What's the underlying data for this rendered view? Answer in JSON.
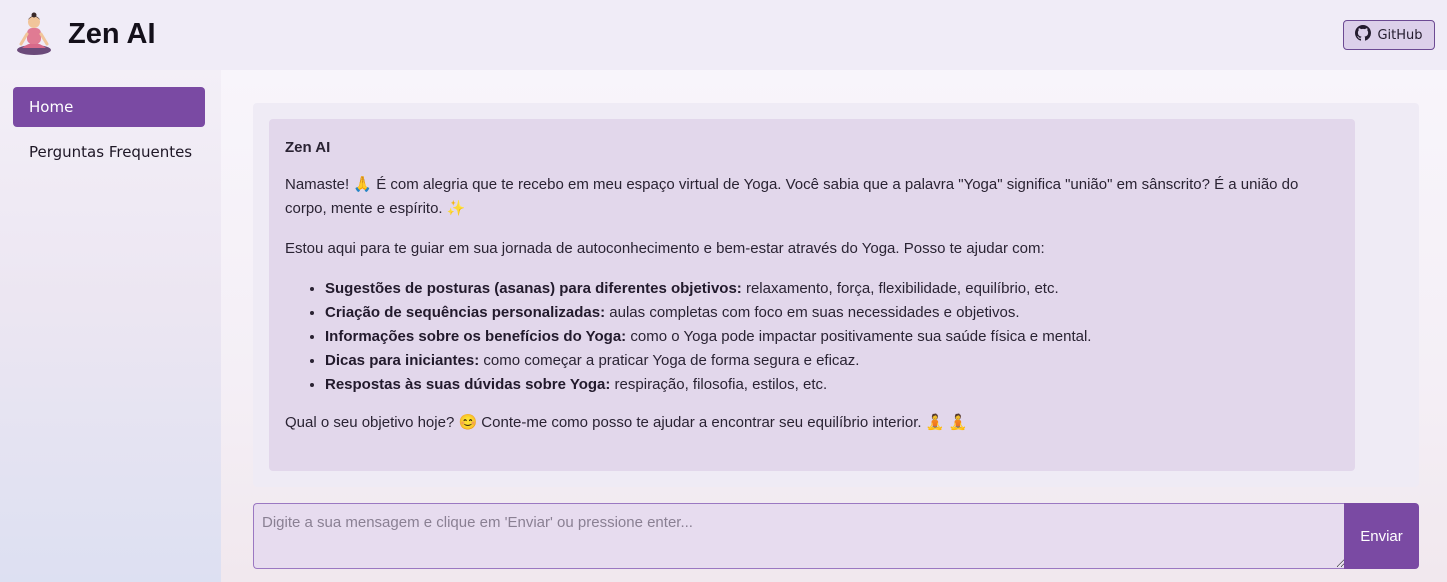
{
  "header": {
    "title": "Zen AI",
    "logo_icon": "meditating-person-icon",
    "github_label": "GitHub"
  },
  "sidebar": {
    "items": [
      {
        "label": "Home",
        "active": true
      },
      {
        "label": "Perguntas Frequentes",
        "active": false
      }
    ]
  },
  "chat": {
    "sender": "Zen AI",
    "intro": "Namaste! 🙏 É com alegria que te recebo em meu espaço virtual de Yoga. Você sabia que a palavra \"Yoga\" significa \"união\" em sânscrito? É a união do corpo, mente e espírito. ✨",
    "help_line": "Estou aqui para te guiar em sua jornada de autoconhecimento e bem-estar através do Yoga. Posso te ajudar com:",
    "features": [
      {
        "title": "Sugestões de posturas (asanas) para diferentes objetivos:",
        "text": " relaxamento, força, flexibilidade, equilíbrio, etc."
      },
      {
        "title": "Criação de sequências personalizadas:",
        "text": " aulas completas com foco em suas necessidades e objetivos."
      },
      {
        "title": "Informações sobre os benefícios do Yoga:",
        "text": " como o Yoga pode impactar positivamente sua saúde física e mental."
      },
      {
        "title": "Dicas para iniciantes:",
        "text": " como começar a praticar Yoga de forma segura e eficaz."
      },
      {
        "title": "Respostas às suas dúvidas sobre Yoga:",
        "text": " respiração, filosofia, estilos, etc."
      }
    ],
    "closing": "Qual o seu objetivo hoje? 😊 Conte-me como posso te ajudar a encontrar seu equilíbrio interior. 🧘 🧘"
  },
  "input": {
    "placeholder": "Digite a sua mensagem e clique em 'Enviar' ou pressione enter...",
    "value": "",
    "send_label": "Enviar"
  },
  "colors": {
    "accent": "#7a4aa3",
    "message_bg": "#e2d7eb",
    "panel_bg": "#efebf5"
  }
}
